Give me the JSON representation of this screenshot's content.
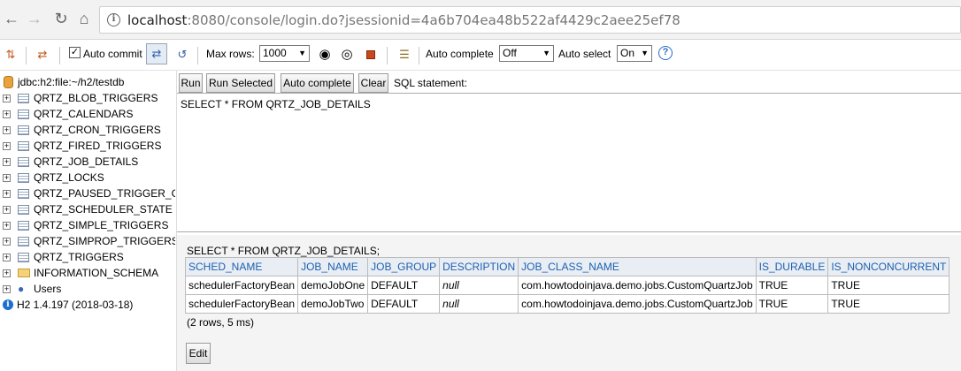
{
  "browser": {
    "url_host": "localhost",
    "url_path": ":8080/console/login.do?jsessionid=4a6b704ea48b522af4429c2aee25ef78"
  },
  "toolbar": {
    "auto_commit_label": "Auto commit",
    "auto_commit_checked": true,
    "max_rows_label": "Max rows:",
    "max_rows_value": "1000",
    "auto_complete_label": "Auto complete",
    "auto_complete_value": "Off",
    "auto_select_label": "Auto select",
    "auto_select_value": "On",
    "help_glyph": "?"
  },
  "tree": {
    "connection": "jdbc:h2:file:~/h2/testdb",
    "tables": [
      "QRTZ_BLOB_TRIGGERS",
      "QRTZ_CALENDARS",
      "QRTZ_CRON_TRIGGERS",
      "QRTZ_FIRED_TRIGGERS",
      "QRTZ_JOB_DETAILS",
      "QRTZ_LOCKS",
      "QRTZ_PAUSED_TRIGGER_GRPS",
      "QRTZ_SCHEDULER_STATE",
      "QRTZ_SIMPLE_TRIGGERS",
      "QRTZ_SIMPROP_TRIGGERS",
      "QRTZ_TRIGGERS"
    ],
    "schema": "INFORMATION_SCHEMA",
    "users": "Users",
    "version": "H2 1.4.197 (2018-03-18)"
  },
  "query": {
    "run_label": "Run",
    "run_selected_label": "Run Selected",
    "auto_complete_label": "Auto complete",
    "clear_label": "Clear",
    "sql_statement_label": "SQL statement:",
    "sql_text": "SELECT * FROM QRTZ_JOB_DETAILS"
  },
  "results": {
    "executed_sql": "SELECT * FROM QRTZ_JOB_DETAILS;",
    "columns": [
      "SCHED_NAME",
      "JOB_NAME",
      "JOB_GROUP",
      "DESCRIPTION",
      "JOB_CLASS_NAME",
      "IS_DURABLE",
      "IS_NONCONCURRENT"
    ],
    "rows": [
      [
        "schedulerFactoryBean",
        "demoJobOne",
        "DEFAULT",
        "null",
        "com.howtodoinjava.demo.jobs.CustomQuartzJob",
        "TRUE",
        "TRUE"
      ],
      [
        "schedulerFactoryBean",
        "demoJobTwo",
        "DEFAULT",
        "null",
        "com.howtodoinjava.demo.jobs.CustomQuartzJob",
        "TRUE",
        "TRUE"
      ]
    ],
    "row_count": "(2 rows, 5 ms)",
    "edit_label": "Edit"
  }
}
